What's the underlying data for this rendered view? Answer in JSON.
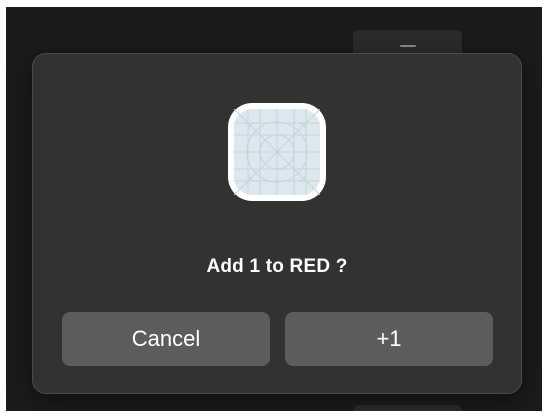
{
  "dialog": {
    "icon": "app-placeholder-icon",
    "title": "Add 1 to RED ?",
    "cancel_label": "Cancel",
    "confirm_label": "+1"
  },
  "colors": {
    "backdrop": "#1b1b1b",
    "dialog_bg": "#323232",
    "button_bg": "#5c5c5c",
    "text": "#ffffff",
    "icon_fill": "#dde8ee"
  }
}
